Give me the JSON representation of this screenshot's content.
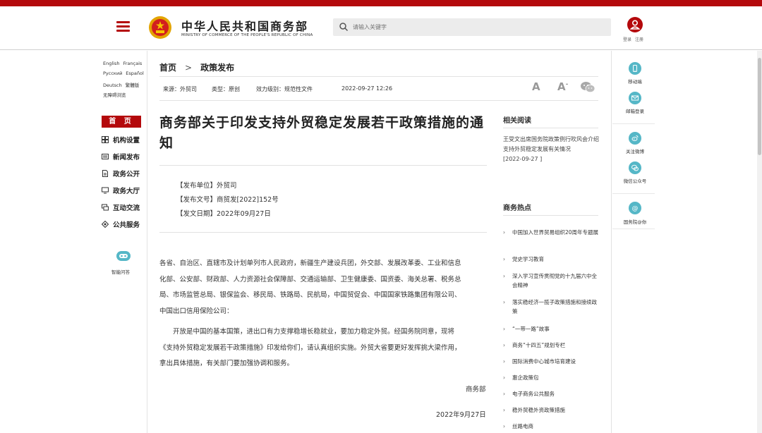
{
  "colors": {
    "brand_red": "#b4090c",
    "accent_teal": "#55b7c7"
  },
  "header": {
    "title": "中华人民共和国商务部",
    "subtitle": "MINISTRY OF COMMERCE OF THE PEOPLE'S REPUBLIC OF CHINA",
    "search_placeholder": "请输入关键字",
    "login": "登录",
    "register": "注册"
  },
  "languages": [
    "English",
    "Français",
    "Русский",
    "Español",
    "Deutsch",
    "繁體版",
    "无障碍浏览"
  ],
  "left_nav": {
    "home": "首 页",
    "items": [
      {
        "label": "机构设置",
        "icon": "org-chart-icon"
      },
      {
        "label": "新闻发布",
        "icon": "news-icon"
      },
      {
        "label": "政务公开",
        "icon": "document-icon"
      },
      {
        "label": "政务大厅",
        "icon": "monitor-icon"
      },
      {
        "label": "互动交流",
        "icon": "chat-icon"
      },
      {
        "label": "公共服务",
        "icon": "service-icon"
      }
    ],
    "bot_label": "智能问答"
  },
  "breadcrumb": {
    "home": "首页",
    "current": "政策发布"
  },
  "meta": {
    "source": "来源：外贸司",
    "type": "类型：原创",
    "level": "效力级别：规范性文件",
    "date": "2022-09-27 12:26"
  },
  "tools": {
    "font_larger": "A",
    "font_smaller": "A",
    "font_smaller_mark": "-"
  },
  "article": {
    "title": "商务部关于印发支持外贸稳定发展若干政策措施的通知",
    "unit": "【发布单位】外贸司",
    "doc_no": "【发布文号】商贸发[2022]152号",
    "issue_date": "【发文日期】2022年09月27日",
    "para1": [
      "各省、自治区、直辖市及计划单列市人民政府，新疆生产建设兵团，外交部、发展改革委、工业和信息",
      "化部、公安部、财政部、人力资源社会保障部、交通运输部、卫生健康委、国资委、海关总署、税务总",
      "局、市场监管总局、银保监会、移民局、铁路局、民航局，中国贸促会、中国国家铁路集团有限公司、",
      "中国出口信用保险公司："
    ],
    "para2": [
      "开放是中国的基本国策，进出口有力支撑稳增长稳就业，要加力稳定外贸。经国务院同意，现将",
      "《支持外贸稳定发展若干政策措施》印发给你们，请认真组织实施。外贸大省要更好发挥挑大梁作用，",
      "拿出具体措施，有关部门要加强协调和服务。"
    ],
    "signer": "商务部",
    "sign_date": "2022年9月27日"
  },
  "related": {
    "title": "相关阅读",
    "text": "王受文出席国务院政策例行吹风会介绍支持外贸稳定发展有关情况",
    "date": "[2022-09-27 ]"
  },
  "hot": {
    "title": "商务热点",
    "items": [
      "中国加入世界贸易组织20周年专题展",
      "党史学习教育",
      "深入学习宣传贯彻党的十九届六中全会精神",
      "落实稳经济一揽子政策措施和接续政策",
      "“一带一路”故事",
      "商务“十四五”规划专栏",
      "国际消费中心城市培育建设",
      "惠企政策包",
      "电子商务公共服务",
      "稳外贸稳外资政策措施",
      "丝路电商"
    ]
  },
  "right_rail": [
    {
      "label": "移动端",
      "icon": "mobile-icon"
    },
    {
      "label": "邮箱登录",
      "icon": "mail-icon"
    },
    {
      "label": "关注微博",
      "icon": "weibo-icon"
    },
    {
      "label": "微信公众号",
      "icon": "wechat-icon"
    },
    {
      "label": "国务院@你",
      "icon": "at-icon"
    }
  ]
}
